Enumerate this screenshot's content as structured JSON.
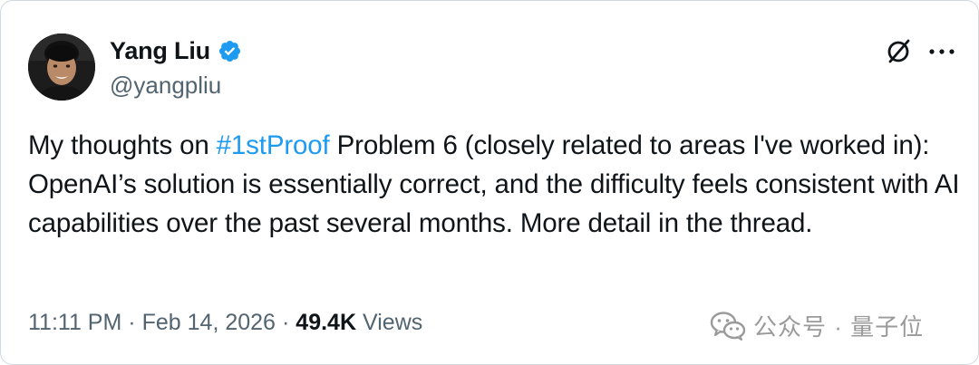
{
  "author": {
    "display_name": "Yang Liu",
    "handle": "@yangpliu",
    "verified": true,
    "avatar_icon": "avatar-photo"
  },
  "actions": {
    "grok_icon": "grok-slash-circle-icon",
    "more_icon": "more-dots-icon"
  },
  "tweet": {
    "text_before": "My thoughts on ",
    "hashtag": "#1stProof",
    "text_after": " Problem 6 (closely related to areas I've worked in): OpenAI’s solution is essentially correct, and the difficulty feels consistent with AI capabilities over the past several months. More detail in the thread."
  },
  "meta": {
    "time": "11:11 PM",
    "separator_1": "·",
    "date": "Feb 14, 2026",
    "separator_2": "·",
    "views_count": "49.4K",
    "views_label": "Views"
  },
  "watermark": {
    "text": "公众号 · 量子位",
    "icon": "wechat-icon"
  },
  "colors": {
    "hashtag": "#1d9bf0",
    "verified": "#1d9bf0",
    "secondary_text": "#536471",
    "primary_text": "#0f1419",
    "watermark": "#9a9a9a"
  }
}
